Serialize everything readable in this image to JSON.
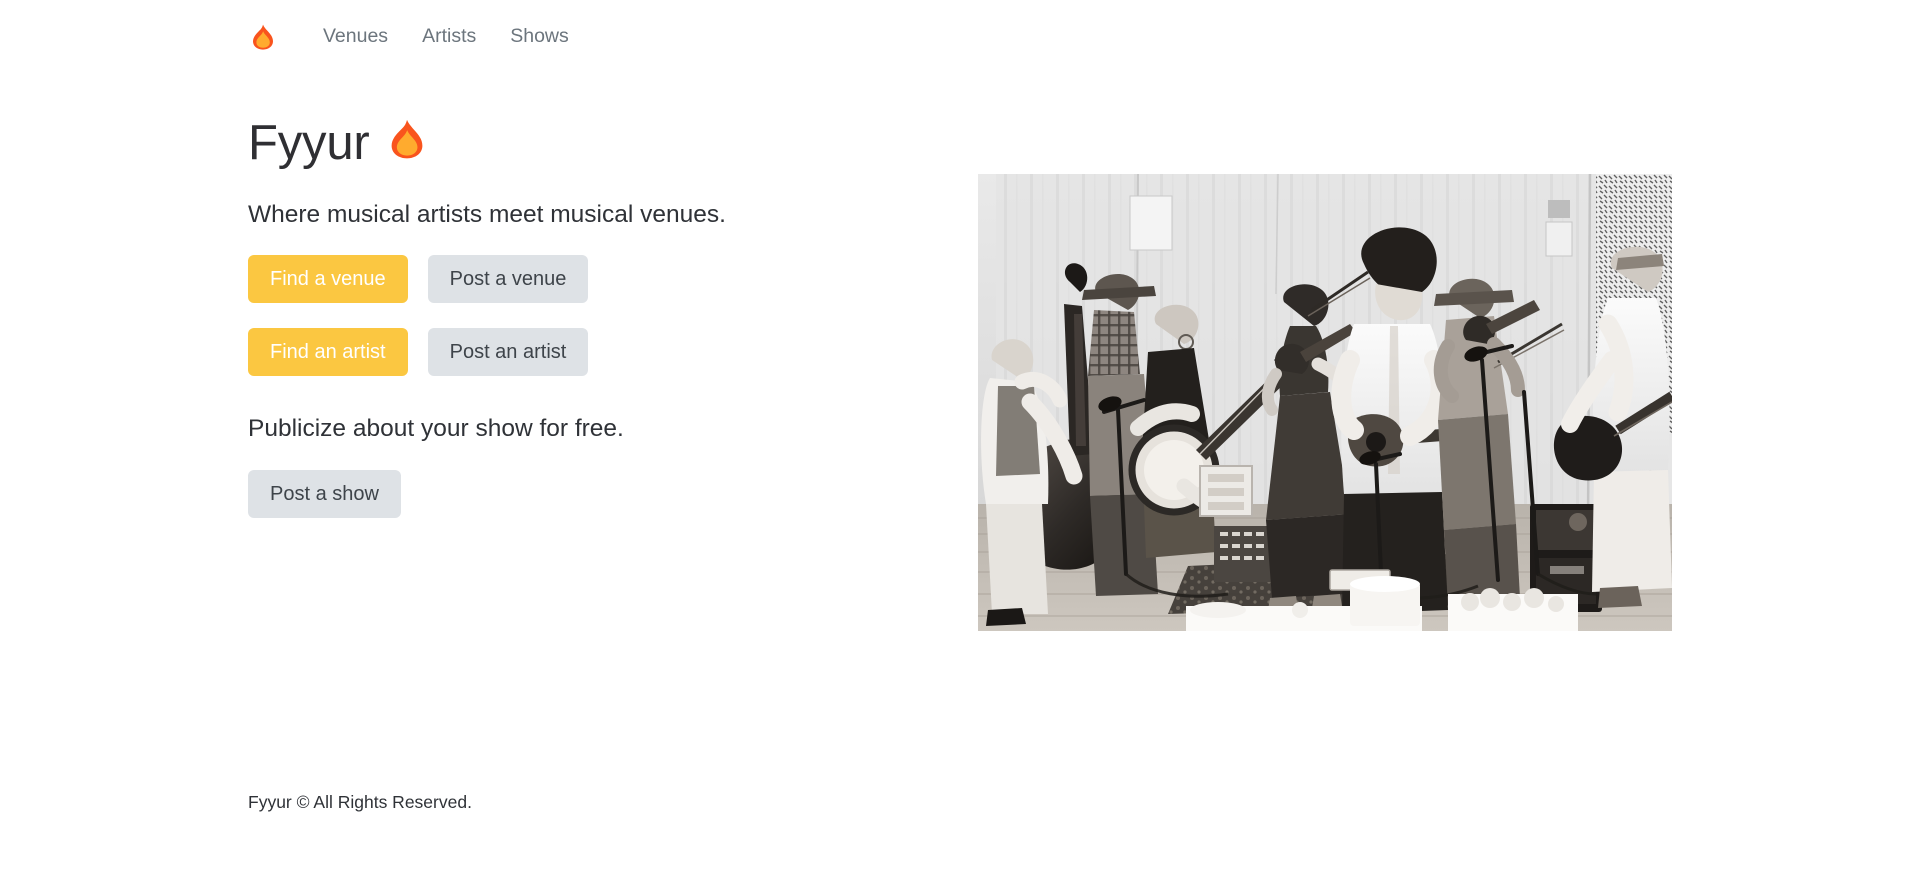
{
  "brand": {
    "name": "Fyyur",
    "logo_icon": "flame-icon",
    "flame_outer_color": "#f9541d",
    "flame_inner_color": "#ffab2e"
  },
  "nav": {
    "items": [
      {
        "label": "Venues"
      },
      {
        "label": "Artists"
      },
      {
        "label": "Shows"
      }
    ]
  },
  "hero": {
    "title": "Fyyur",
    "title_icon": "flame-icon",
    "subtitle": "Where musical artists meet musical venues.",
    "actions_primary": [
      {
        "label": "Find a venue"
      },
      {
        "label": "Find an artist"
      }
    ],
    "actions_secondary": [
      {
        "label": "Post a venue"
      },
      {
        "label": "Post an artist"
      }
    ],
    "show_tagline": "Publicize about your show for free.",
    "show_action": {
      "label": "Post a show"
    },
    "image": {
      "alt": "Black and white photo of a folk band performing live in a tent with upright bass, banjo, fiddles, guitars and mandolin",
      "style": "black-and-white-photograph"
    }
  },
  "colors": {
    "primary_button": "#fbc741",
    "primary_button_text": "#ffffff",
    "secondary_button": "#dee2e6",
    "secondary_button_text": "#3e444a",
    "nav_link": "#6c757d",
    "body_text": "#2f3237",
    "background": "#ffffff"
  },
  "footer": {
    "copyright": "Fyyur © All Rights Reserved."
  }
}
